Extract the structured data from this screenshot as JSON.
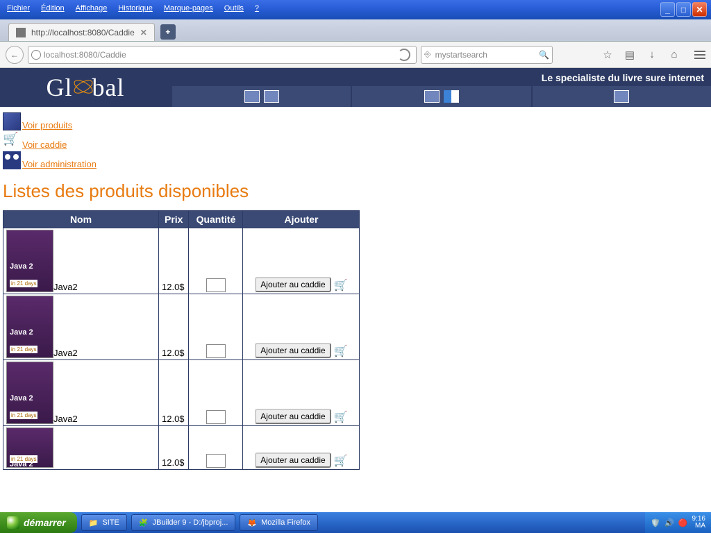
{
  "os_menu": {
    "file": "Fichier",
    "edit": "Édition",
    "view": "Affichage",
    "history": "Historique",
    "bookmarks": "Marque-pages",
    "tools": "Outils",
    "help": "?"
  },
  "tab": {
    "title": "http://localhost:8080/Caddie"
  },
  "url": "localhost:8080/Caddie",
  "search_placeholder": "mystartsearch",
  "tagline": "Le specialiste du livre sure internet",
  "logo": {
    "left": "Gl",
    "right": "bal"
  },
  "sidelinks": {
    "produits": "Voir produits",
    "caddie": "Voir caddie",
    "admin": "Voir administration"
  },
  "page_title": "Listes des produits disponibles",
  "table": {
    "headers": {
      "nom": "Nom",
      "prix": "Prix",
      "qty": "Quantité",
      "add": "Ajouter"
    },
    "add_button": "Ajouter au caddie",
    "rows": [
      {
        "name": "Java2",
        "price": "12.0$"
      },
      {
        "name": "Java2",
        "price": "12.0$"
      },
      {
        "name": "Java2",
        "price": "12.0$"
      },
      {
        "name": "",
        "price": "12.0$"
      }
    ]
  },
  "taskbar": {
    "start": "démarrer",
    "items": [
      "SITE",
      "JBuilder 9 - D:/jbproj...",
      "Mozilla Firefox"
    ],
    "clock": {
      "time": "9:16",
      "ampm": "MA"
    }
  }
}
